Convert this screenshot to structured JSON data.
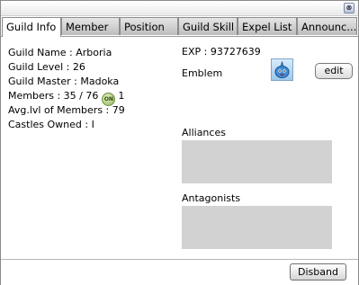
{
  "titlebar": {
    "close_glyph": "⊗",
    "close_icon": "close-icon"
  },
  "tabs": [
    {
      "label": "Guild Info",
      "active": true
    },
    {
      "label": "Member"
    },
    {
      "label": "Position"
    },
    {
      "label": "Guild Skill"
    },
    {
      "label": "Expel List"
    },
    {
      "label": "Announc..."
    }
  ],
  "info": {
    "guild_name": "Guild Name : Arboria",
    "guild_level": "Guild Level : 26",
    "guild_master": "Guild Master : Madoka",
    "members": "Members : 35 / 76",
    "online_badge": "ON",
    "online_count": "1",
    "avg_lvl": "Avg.lvl of Members : 79",
    "castles_owned": "Castles Owned : I"
  },
  "exp": "EXP : 93727639",
  "emblem": {
    "label": "Emblem",
    "icon": "emblem-icon",
    "edit_label": "edit"
  },
  "alliances": {
    "label": "Alliances"
  },
  "antagonists": {
    "label": "Antagonists"
  },
  "footer": {
    "disband_label": "Disband"
  }
}
